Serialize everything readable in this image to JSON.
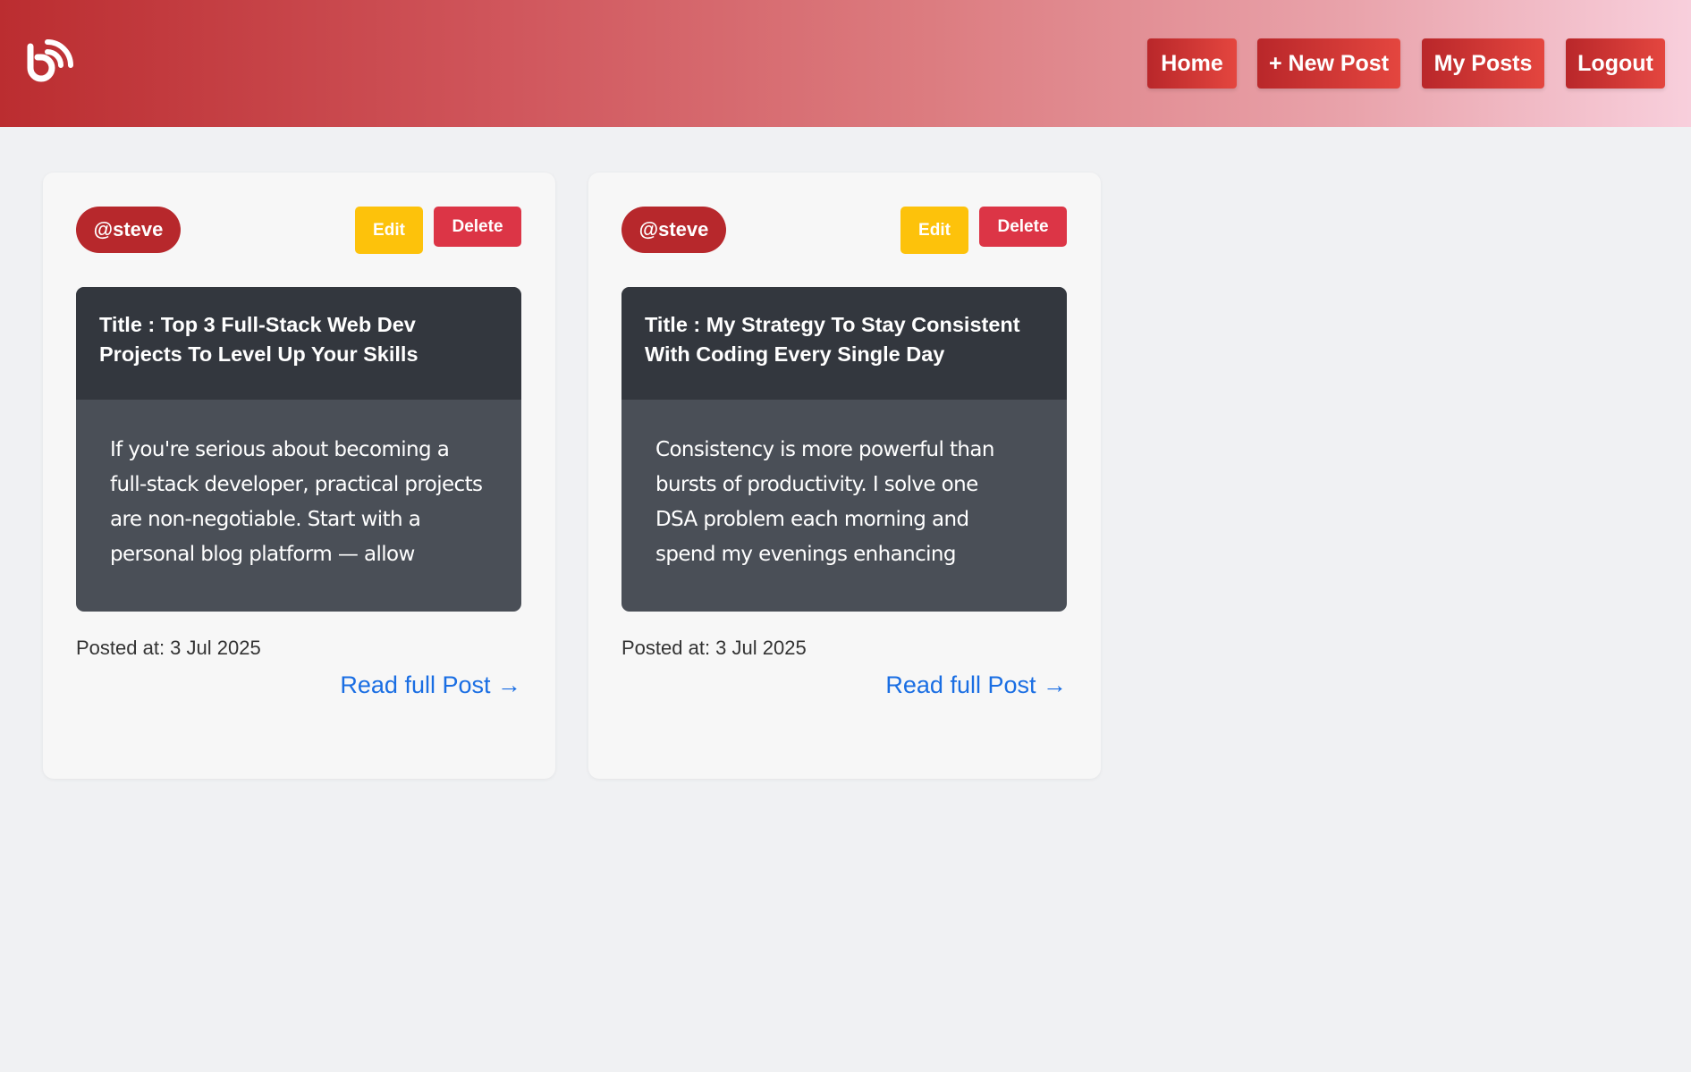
{
  "nav": {
    "logo_icon": "blog-logo-icon",
    "buttons": [
      "Home",
      "+ New Post",
      "My Posts",
      "Logout"
    ]
  },
  "posts": [
    {
      "author": "@steve",
      "edit_label": "Edit",
      "delete_label": "Delete",
      "title": "Title : Top 3 Full-Stack Web Dev Projects To Level Up Your Skills",
      "excerpt_lines": [
        "If you're serious about becoming a",
        "full-stack developer, practical projects",
        "are non-negotiable. Start with a",
        "personal blog platform — allow"
      ],
      "posted_at": "Posted at: 3 Jul 2025",
      "read_more": "Read full Post →"
    },
    {
      "author": "@steve",
      "edit_label": "Edit",
      "delete_label": "Delete",
      "title": "Title : My Strategy To Stay Consistent With Coding Every Single Day",
      "excerpt_lines": [
        "Consistency is more powerful than",
        "bursts of productivity. I solve one",
        "DSA problem each morning and",
        "spend my evenings enhancing"
      ],
      "posted_at": "Posted at: 3 Jul 2025",
      "read_more": "Read full Post →"
    }
  ],
  "colors": {
    "brand_red": "#b7282c",
    "edit_yellow": "#fdc20b",
    "delete_red": "#dc3546",
    "link_blue": "#1a6ee3"
  }
}
